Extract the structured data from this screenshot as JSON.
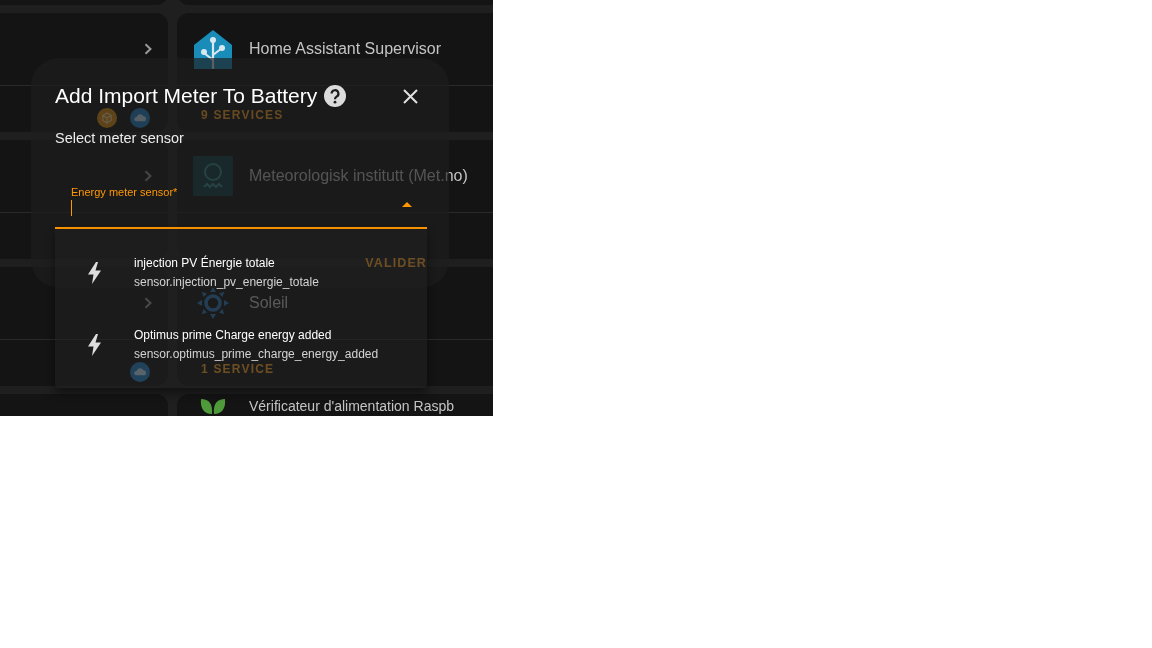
{
  "background": {
    "left_cards": [
      {
        "kind": "link",
        "badges": [
          {
            "kind": "addon"
          },
          {
            "kind": "cloud"
          }
        ]
      },
      {
        "kind": "link"
      },
      {
        "kind": "link",
        "badges": [
          {
            "kind": "cloud"
          }
        ]
      }
    ],
    "integrations": [
      {
        "kind": "supervisor",
        "title": "Home Assistant Supervisor",
        "footer": "9 SERVICES"
      },
      {
        "kind": "metno",
        "title": "Meteorologisk institutt (Met.no)"
      },
      {
        "kind": "sun",
        "title": "Soleil",
        "footer": "1 SERVICE"
      },
      {
        "kind": "leaf",
        "title": "Vérificateur d'alimentation Raspb"
      }
    ]
  },
  "dialog": {
    "title": "Add Import Meter To Battery",
    "heading": "Select meter sensor",
    "sensor_field": {
      "label": "Energy meter sensor*",
      "focused": true,
      "expanded": true
    },
    "options": [
      {
        "title": "injection PV Énergie totale",
        "entity_id": "sensor.injection_pv_energie_totale",
        "selected": false
      },
      {
        "title": "Optimus prime Charge energy added",
        "entity_id": "sensor.optimus_prime_charge_energy_added",
        "selected": false
      }
    ],
    "buttons": [
      "VALIDER"
    ]
  }
}
